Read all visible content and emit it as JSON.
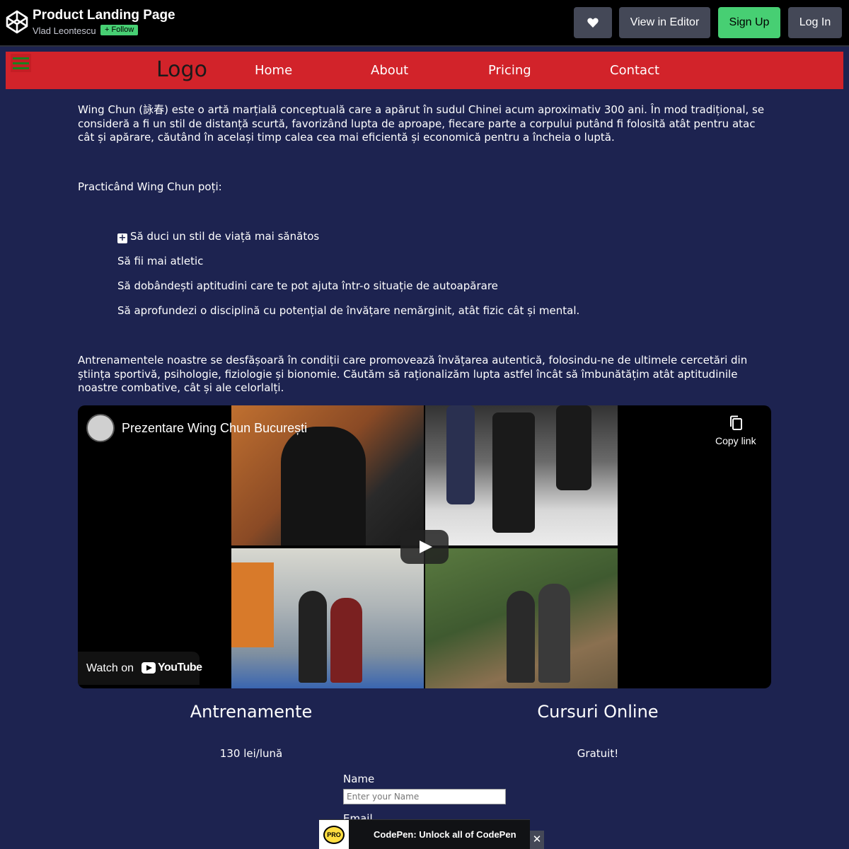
{
  "codepen": {
    "title": "Product Landing Page",
    "author": "Vlad Leontescu",
    "follow_label": "+ Follow",
    "heart_icon": "heart-icon",
    "editor_label": "View in Editor",
    "signup_label": "Sign Up",
    "login_label": "Log In",
    "accent_color": "#47cf73"
  },
  "nav": {
    "logo": "Logo",
    "links": [
      "Home",
      "About",
      "Pricing",
      "Contact"
    ],
    "background_color": "#d2232a"
  },
  "content": {
    "intro": "Wing Chun (詠春) este o artă marțială conceptuală care a apărut în sudul Chinei acum aproximativ 300 ani. În mod tradițional, se consideră a fi un stil de distanță scurtă, favorizând lupta de aproape, fiecare parte a corpului putând fi folosită atât pentru atac cât și apărare, căutând în același timp calea cea mai eficientă și economică pentru a încheia o luptă.",
    "list_intro": "Practicând Wing Chun poți:",
    "benefits": [
      "Să duci un stil de viață mai sănătos",
      "Să fii mai atletic",
      "Să dobândești aptitudini care te pot ajuta într-o situație de autoapărare",
      "Să aprofundezi o disciplină cu potențial de învățare nemărginit, atât fizic cât și mental."
    ],
    "training": "Antrenamentele noastre se desfășoară în condiții care promovează învățarea autentică, folosindu-ne de ultimele cercetări din știința sportivă, psihologie, fiziologie și bionomie. Căutăm să raționalizăm lupta astfel încât să îmbunătățim atât aptitudinile noastre combative, cât și ale celorlalți."
  },
  "video": {
    "title": "Prezentare Wing Chun București",
    "copy_label": "Copy link",
    "watch_label": "Watch on",
    "youtube_label": "YouTube"
  },
  "pricing": [
    {
      "title": "Antrenamente",
      "price": "130 lei/lună"
    },
    {
      "title": "Cursuri Online",
      "price": "Gratuit!"
    }
  ],
  "form": {
    "name_label": "Name",
    "name_placeholder": "Enter your Name",
    "email_label": "Email"
  },
  "toast": {
    "badge": "PRO",
    "text": "CodePen: Unlock all of CodePen",
    "close": "✕"
  }
}
